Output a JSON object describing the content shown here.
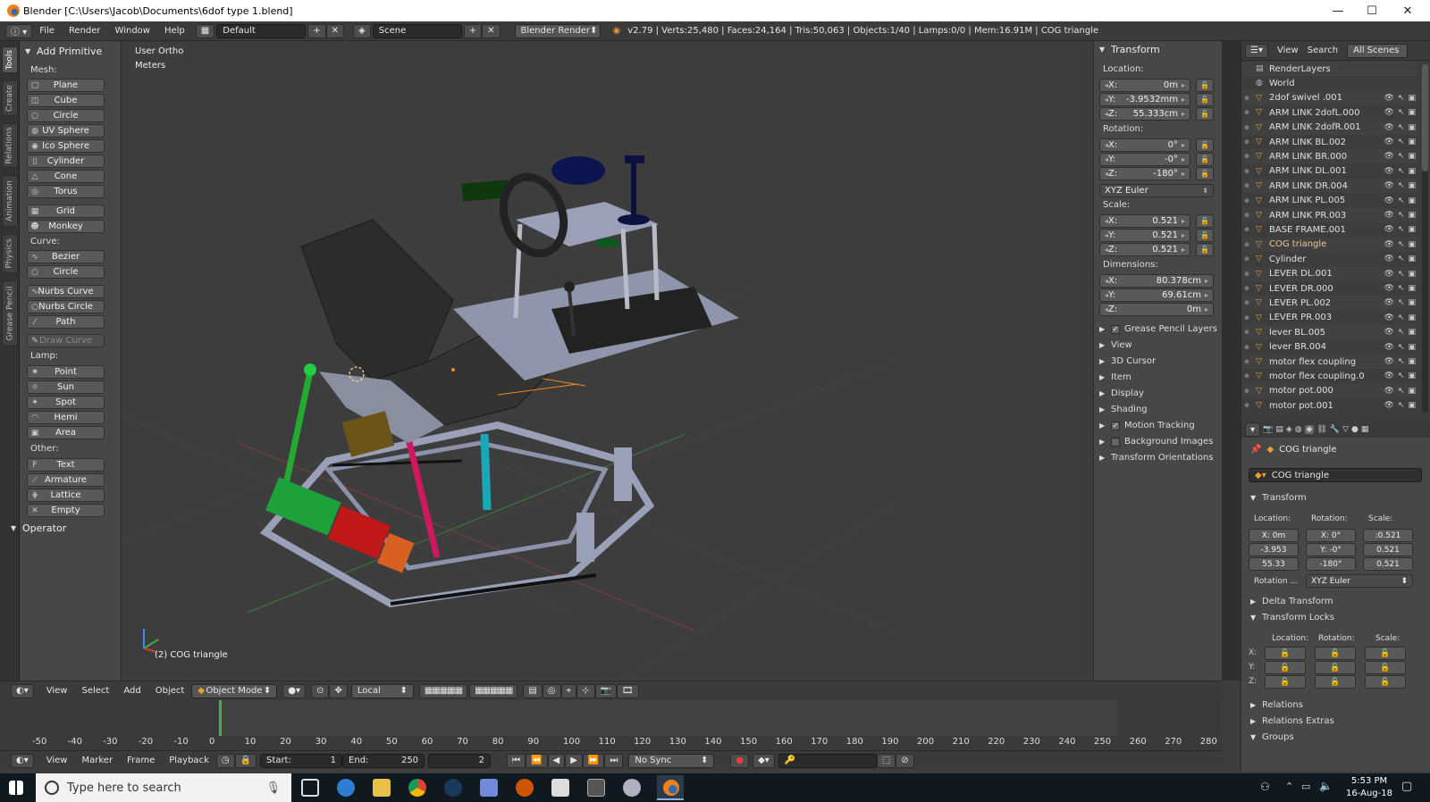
{
  "window": {
    "title": "Blender [C:\\Users\\Jacob\\Documents\\6dof type 1.blend]"
  },
  "menubar": {
    "menus": [
      "File",
      "Render",
      "Window",
      "Help"
    ],
    "layout": "Default",
    "scene": "Scene",
    "engine": "Blender Render",
    "stats": "v2.79 | Verts:25,480 | Faces:24,164 | Tris:50,063 | Objects:1/40 | Lamps:0/0 | Mem:16.91M | COG triangle"
  },
  "tool_tabs": [
    "Tools",
    "Create",
    "Relations",
    "Animation",
    "Physics",
    "Grease Pencil"
  ],
  "toolshelf": {
    "panel_title": "Add Primitive",
    "mesh_label": "Mesh:",
    "mesh": [
      "Plane",
      "Cube",
      "Circle",
      "UV Sphere",
      "Ico Sphere",
      "Cylinder",
      "Cone",
      "Torus",
      "Grid",
      "Monkey"
    ],
    "curve_label": "Curve:",
    "curve": [
      "Bezier",
      "Circle",
      "Nurbs Curve",
      "Nurbs Circle",
      "Path",
      "Draw Curve"
    ],
    "lamp_label": "Lamp:",
    "lamp": [
      "Point",
      "Sun",
      "Spot",
      "Hemi",
      "Area"
    ],
    "other_label": "Other:",
    "other": [
      "Text",
      "Armature",
      "Lattice",
      "Empty"
    ],
    "operator": "Operator"
  },
  "viewport": {
    "view_name": "User Ortho",
    "units": "Meters",
    "object_label": "(2) COG triangle"
  },
  "npanel": {
    "title": "Transform",
    "location_label": "Location:",
    "location": [
      "X:",
      "0m",
      "Y:",
      "-3.9532mm",
      "Z:",
      "55.333cm"
    ],
    "rotation_label": "Rotation:",
    "rotation": [
      "X:",
      "0°",
      "Y:",
      "-0°",
      "Z:",
      "-180°"
    ],
    "rotation_mode": "XYZ Euler",
    "scale_label": "Scale:",
    "scale": [
      "X:",
      "0.521",
      "Y:",
      "0.521",
      "Z:",
      "0.521"
    ],
    "dimensions_label": "Dimensions:",
    "dimensions": [
      "X:",
      "80.378cm",
      "Y:",
      "69.61cm",
      "Z:",
      "0m"
    ],
    "sections": [
      "Grease Pencil Layers",
      "View",
      "3D Cursor",
      "Item",
      "Display",
      "Shading",
      "Motion Tracking",
      "Background Images",
      "Transform Orientations"
    ]
  },
  "outliner": {
    "header": [
      "View",
      "Search",
      "All Scenes"
    ],
    "rows": [
      "RenderLayers",
      "World",
      "2dof swivel .001",
      "ARM LINK 2dofL.000",
      "ARM LINK 2dofR.001",
      "ARM LINK BL.002",
      "ARM LINK BR.000",
      "ARM LINK DL.001",
      "ARM LINK DR.004",
      "ARM LINK PL.005",
      "ARM LINK PR.003",
      "BASE FRAME.001",
      "COG triangle",
      "Cylinder",
      "LEVER DL.001",
      "LEVER DR.000",
      "LEVER PL.002",
      "LEVER PR.003",
      "lever BL.005",
      "lever BR.004",
      "motor flex coupling",
      "motor flex coupling.0",
      "motor pot.000",
      "motor pot.001"
    ]
  },
  "properties": {
    "breadcrumb": "COG triangle",
    "object_name": "COG triangle",
    "transform_title": "Transform",
    "col_labels": [
      "Location:",
      "Rotation:",
      "Scale:"
    ],
    "loc": [
      "X: 0m",
      "-3.953",
      "55.33"
    ],
    "rot": [
      "X: 0°",
      "Y: -0°",
      "-180°"
    ],
    "scl": [
      ":0.521",
      "0.521",
      "0.521"
    ],
    "rotation_label": "Rotation ...",
    "rotation_mode": "XYZ Euler",
    "sections": [
      "Delta Transform",
      "Transform Locks"
    ],
    "locks_labels": [
      "Location:",
      "Rotation:",
      "Scale:"
    ],
    "axes": [
      "X:",
      "Y:",
      "Z:"
    ],
    "more_sections": [
      "Relations",
      "Relations Extras",
      "Groups"
    ]
  },
  "viewport_header": {
    "menus": [
      "View",
      "Select",
      "Add",
      "Object"
    ],
    "mode": "Object Mode",
    "orientation": "Local"
  },
  "timeline": {
    "ticks": [
      "-50",
      "-40",
      "-30",
      "-20",
      "-10",
      "0",
      "10",
      "20",
      "30",
      "40",
      "50",
      "60",
      "70",
      "80",
      "90",
      "100",
      "110",
      "120",
      "130",
      "140",
      "150",
      "160",
      "170",
      "180",
      "190",
      "200",
      "210",
      "220",
      "230",
      "240",
      "250",
      "260",
      "270",
      "280"
    ],
    "current_frame": 2,
    "menus": [
      "View",
      "Marker",
      "Frame",
      "Playback"
    ],
    "start": "Start:",
    "start_val": "1",
    "end": "End:",
    "end_val": "250",
    "frame": "2",
    "sync": "No Sync"
  },
  "taskbar": {
    "search_placeholder": "Type here to search",
    "time": "5:53 PM",
    "date": "16-Aug-18"
  }
}
